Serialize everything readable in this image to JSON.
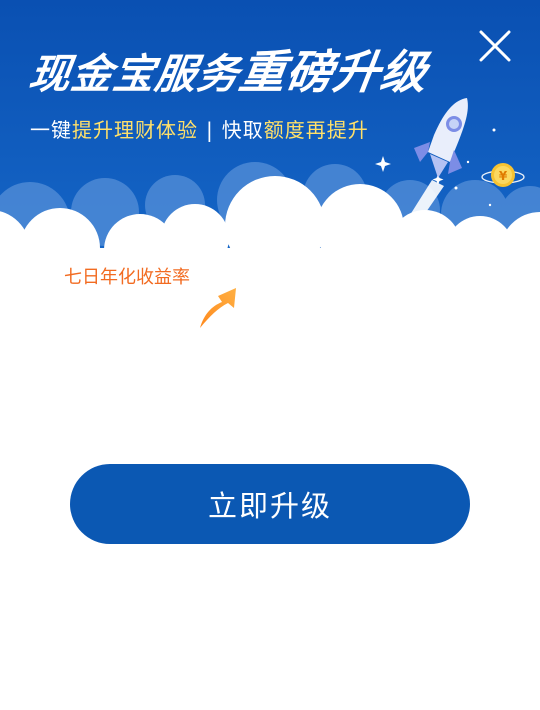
{
  "header": {
    "title_part1": "现金宝服务",
    "title_part2": "重磅升级",
    "subtitle_prefix": "一键",
    "subtitle_hl1": "提升理财体验",
    "subtitle_sep": "|",
    "subtitle_mid": "快取",
    "subtitle_hl2": "额度再提升"
  },
  "main": {
    "rate_label": "七日年化收益率"
  },
  "cta": {
    "label": "立即升级"
  },
  "colors": {
    "header_blue": "#0b55b4",
    "highlight_yellow": "#ffe06a",
    "rate_orange": "#f26b21",
    "button_blue": "#0b58b3"
  },
  "icons": {
    "close": "close-icon",
    "arrow": "arrow-up-icon",
    "rocket": "rocket-icon",
    "coin": "yuan-coin-icon"
  }
}
